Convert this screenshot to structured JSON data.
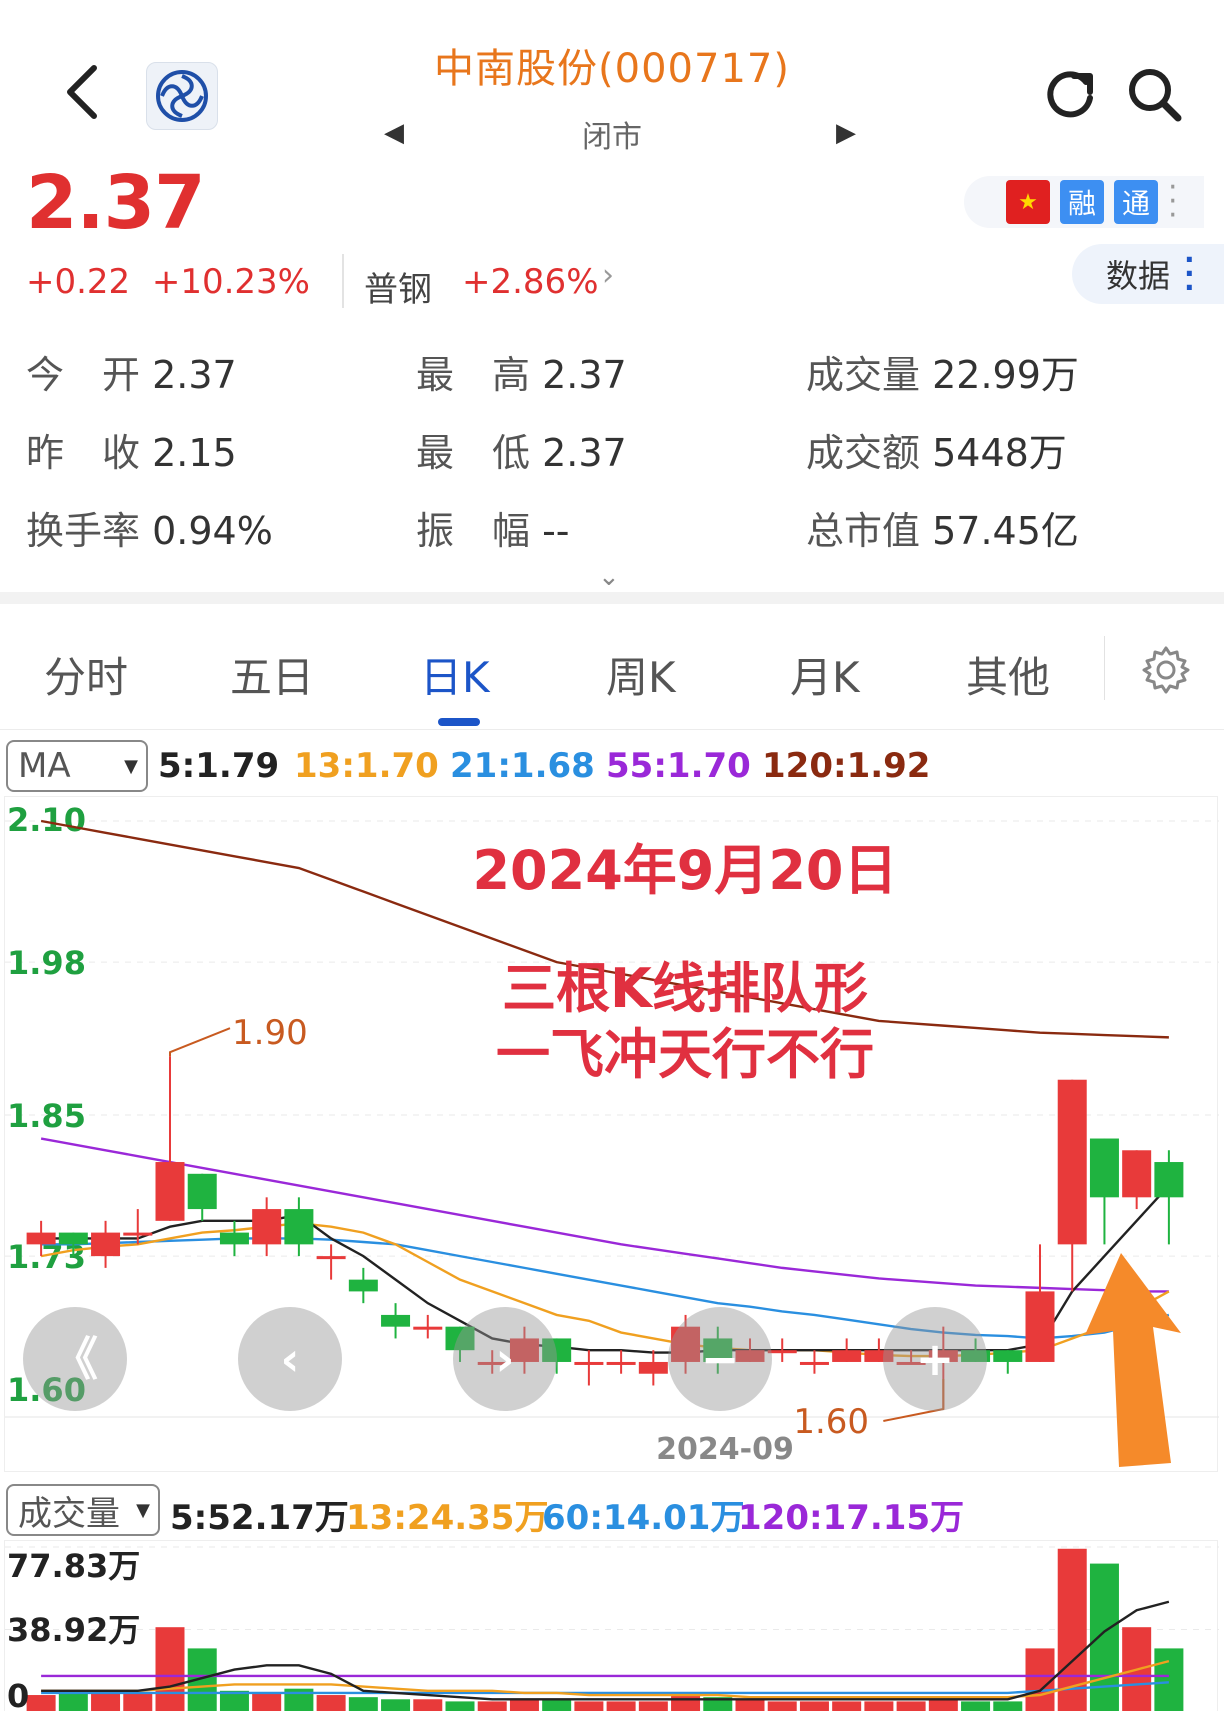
{
  "header": {
    "title": "中南股份(000717)",
    "market_state": "闭市",
    "prev_arrow": "◀",
    "next_arrow": "▶"
  },
  "quote": {
    "price": "2.37",
    "change": "+0.22",
    "change_pct": "+10.23%",
    "sector_name": "普钢",
    "sector_change": "+2.86%"
  },
  "badges": {
    "margin": "融",
    "connect": "通",
    "flag": "★"
  },
  "data_button": {
    "label": "数据"
  },
  "stats": [
    {
      "label": "今　开",
      "value": "2.37"
    },
    {
      "label": "最　高",
      "value": "2.37"
    },
    {
      "label": "成交量",
      "value": "22.99万"
    },
    {
      "label": "昨　收",
      "value": "2.15"
    },
    {
      "label": "最　低",
      "value": "2.37"
    },
    {
      "label": "成交额",
      "value": "5448万"
    },
    {
      "label": "换手率",
      "value": "0.94%"
    },
    {
      "label": "振　幅",
      "value": "--"
    },
    {
      "label": "总市值",
      "value": "57.45亿"
    }
  ],
  "tabs": [
    "分时",
    "五日",
    "日K",
    "周K",
    "月K",
    "其他"
  ],
  "active_tab": 2,
  "ma_bar": {
    "selector": "MA",
    "items": [
      {
        "text": "5:1.79",
        "color": "#222222"
      },
      {
        "text": "13:1.70",
        "color": "#f0a020"
      },
      {
        "text": "21:1.68",
        "color": "#2a8fe0"
      },
      {
        "text": "55:1.70",
        "color": "#9a28d8"
      },
      {
        "text": "120:1.92",
        "color": "#8a2a10"
      }
    ]
  },
  "vol_bar": {
    "selector": "成交量",
    "items": [
      {
        "text": "5:52.17万",
        "color": "#222222"
      },
      {
        "text": "13:24.35万",
        "color": "#f0a020"
      },
      {
        "text": "60:14.01万",
        "color": "#2a8fe0"
      },
      {
        "text": "120:17.15万",
        "color": "#9a28d8"
      }
    ]
  },
  "annotations": {
    "date": "2024年9月20日",
    "line1": "三根K线排队形",
    "line2": "一飞冲天行不行",
    "high_marker": "1.90",
    "low_marker": "1.60"
  },
  "controls": [
    "《",
    "‹",
    "›",
    "−",
    "+"
  ],
  "colors": {
    "up": "#e83a3a",
    "down": "#1fb340",
    "accent": "#1c55c8",
    "title": "#e8761c"
  },
  "chart_data": {
    "type": "candlestick",
    "x_label": "2024-09",
    "price_axis": [
      "2.10",
      "1.98",
      "1.85",
      "1.73",
      "1.60"
    ],
    "ylim": [
      1.6,
      2.1
    ],
    "candles": [
      {
        "o": 1.74,
        "c": 1.75,
        "h": 1.76,
        "l": 1.73
      },
      {
        "o": 1.75,
        "c": 1.74,
        "h": 1.75,
        "l": 1.73
      },
      {
        "o": 1.73,
        "c": 1.75,
        "h": 1.76,
        "l": 1.72
      },
      {
        "o": 1.75,
        "c": 1.75,
        "h": 1.77,
        "l": 1.74
      },
      {
        "o": 1.76,
        "c": 1.81,
        "h": 1.9,
        "l": 1.76
      },
      {
        "o": 1.8,
        "c": 1.77,
        "h": 1.8,
        "l": 1.76
      },
      {
        "o": 1.75,
        "c": 1.74,
        "h": 1.76,
        "l": 1.73
      },
      {
        "o": 1.74,
        "c": 1.77,
        "h": 1.78,
        "l": 1.73
      },
      {
        "o": 1.77,
        "c": 1.74,
        "h": 1.78,
        "l": 1.73
      },
      {
        "o": 1.73,
        "c": 1.73,
        "h": 1.74,
        "l": 1.71
      },
      {
        "o": 1.71,
        "c": 1.7,
        "h": 1.72,
        "l": 1.69
      },
      {
        "o": 1.68,
        "c": 1.67,
        "h": 1.69,
        "l": 1.66
      },
      {
        "o": 1.67,
        "c": 1.67,
        "h": 1.68,
        "l": 1.66
      },
      {
        "o": 1.67,
        "c": 1.65,
        "h": 1.67,
        "l": 1.64
      },
      {
        "o": 1.64,
        "c": 1.64,
        "h": 1.65,
        "l": 1.63
      },
      {
        "o": 1.64,
        "c": 1.66,
        "h": 1.67,
        "l": 1.63
      },
      {
        "o": 1.66,
        "c": 1.64,
        "h": 1.66,
        "l": 1.63
      },
      {
        "o": 1.64,
        "c": 1.64,
        "h": 1.65,
        "l": 1.62
      },
      {
        "o": 1.64,
        "c": 1.64,
        "h": 1.65,
        "l": 1.63
      },
      {
        "o": 1.63,
        "c": 1.64,
        "h": 1.65,
        "l": 1.62
      },
      {
        "o": 1.64,
        "c": 1.67,
        "h": 1.68,
        "l": 1.63
      },
      {
        "o": 1.66,
        "c": 1.64,
        "h": 1.67,
        "l": 1.63
      },
      {
        "o": 1.64,
        "c": 1.65,
        "h": 1.66,
        "l": 1.64
      },
      {
        "o": 1.65,
        "c": 1.65,
        "h": 1.66,
        "l": 1.64
      },
      {
        "o": 1.64,
        "c": 1.64,
        "h": 1.65,
        "l": 1.63
      },
      {
        "o": 1.64,
        "c": 1.65,
        "h": 1.66,
        "l": 1.64
      },
      {
        "o": 1.64,
        "c": 1.65,
        "h": 1.66,
        "l": 1.64
      },
      {
        "o": 1.64,
        "c": 1.64,
        "h": 1.65,
        "l": 1.64
      },
      {
        "o": 1.64,
        "c": 1.65,
        "h": 1.67,
        "l": 1.6
      },
      {
        "o": 1.65,
        "c": 1.64,
        "h": 1.66,
        "l": 1.64
      },
      {
        "o": 1.65,
        "c": 1.64,
        "h": 1.65,
        "l": 1.63
      },
      {
        "o": 1.64,
        "c": 1.7,
        "h": 1.74,
        "l": 1.64
      },
      {
        "o": 1.74,
        "c": 1.88,
        "h": 1.88,
        "l": 1.7
      },
      {
        "o": 1.83,
        "c": 1.78,
        "h": 1.83,
        "l": 1.74
      },
      {
        "o": 1.78,
        "c": 1.82,
        "h": 1.82,
        "l": 1.77
      },
      {
        "o": 1.81,
        "c": 1.78,
        "h": 1.82,
        "l": 1.74
      }
    ],
    "ma5": [
      1.745,
      1.745,
      1.745,
      1.745,
      1.755,
      1.76,
      1.76,
      1.76,
      1.765,
      1.745,
      1.73,
      1.71,
      1.69,
      1.675,
      1.66,
      1.655,
      1.653,
      1.65,
      1.65,
      1.648,
      1.648,
      1.65,
      1.65,
      1.65,
      1.65,
      1.65,
      1.65,
      1.65,
      1.65,
      1.65,
      1.65,
      1.655,
      1.7,
      1.73,
      1.76,
      1.79
    ],
    "ma13": [
      1.73,
      1.735,
      1.738,
      1.74,
      1.745,
      1.75,
      1.752,
      1.755,
      1.758,
      1.755,
      1.75,
      1.74,
      1.725,
      1.71,
      1.7,
      1.69,
      1.68,
      1.675,
      1.665,
      1.66,
      1.655,
      1.652,
      1.65,
      1.65,
      1.65,
      1.648,
      1.646,
      1.645,
      1.645,
      1.646,
      1.648,
      1.65,
      1.66,
      1.67,
      1.685,
      1.7
    ],
    "ma21": [
      1.74,
      1.74,
      1.741,
      1.742,
      1.743,
      1.744,
      1.745,
      1.745,
      1.745,
      1.744,
      1.742,
      1.74,
      1.735,
      1.73,
      1.725,
      1.72,
      1.715,
      1.71,
      1.705,
      1.7,
      1.695,
      1.69,
      1.687,
      1.683,
      1.68,
      1.676,
      1.672,
      1.668,
      1.665,
      1.663,
      1.662,
      1.66,
      1.662,
      1.665,
      1.672,
      1.68
    ],
    "ma55": [
      1.83,
      1.825,
      1.82,
      1.815,
      1.81,
      1.805,
      1.8,
      1.795,
      1.79,
      1.785,
      1.78,
      1.775,
      1.77,
      1.765,
      1.76,
      1.755,
      1.75,
      1.745,
      1.74,
      1.736,
      1.732,
      1.728,
      1.724,
      1.72,
      1.717,
      1.714,
      1.711,
      1.709,
      1.707,
      1.705,
      1.704,
      1.703,
      1.702,
      1.701,
      1.7,
      1.7
    ],
    "ma120": [
      2.1,
      2.095,
      2.09,
      2.085,
      2.08,
      2.075,
      2.07,
      2.065,
      2.06,
      2.05,
      2.04,
      2.03,
      2.02,
      2.01,
      2.0,
      1.99,
      1.98,
      1.975,
      1.97,
      1.965,
      1.96,
      1.955,
      1.95,
      1.945,
      1.94,
      1.935,
      1.93,
      1.928,
      1.926,
      1.924,
      1.922,
      1.92,
      1.919,
      1.918,
      1.917,
      1.916
    ],
    "volume_axis": [
      "77.83万",
      "38.92万",
      "0"
    ],
    "volume": [
      8,
      9,
      10,
      9,
      40,
      30,
      10,
      9,
      11,
      8,
      7,
      6,
      6,
      5,
      5,
      6,
      6,
      5,
      5,
      5,
      8,
      7,
      6,
      5,
      5,
      5,
      5,
      5,
      6,
      5,
      5,
      30,
      77,
      70,
      40,
      30
    ],
    "vol_ma5": [
      10,
      10,
      10,
      10,
      12,
      16,
      20,
      22,
      22,
      18,
      10,
      9,
      8,
      7,
      6,
      6,
      6,
      6,
      6,
      6,
      6,
      6,
      6,
      6,
      6,
      6,
      6,
      6,
      6,
      6,
      6,
      10,
      24,
      38,
      48,
      52
    ],
    "vol_ma13": [
      10,
      10,
      10,
      10,
      11,
      12,
      13,
      13,
      13,
      13,
      12,
      11,
      10,
      10,
      10,
      9,
      9,
      8,
      8,
      8,
      8,
      8,
      7,
      7,
      7,
      7,
      7,
      7,
      7,
      7,
      7,
      8,
      12,
      16,
      20,
      24
    ],
    "vol_ma60": [
      9,
      9,
      9,
      9,
      9,
      9,
      9,
      9,
      9,
      9,
      9,
      9,
      9,
      9,
      9,
      9,
      9,
      9,
      9,
      9,
      9,
      9,
      9,
      9,
      9,
      9,
      9,
      9,
      9,
      9,
      9,
      10,
      11,
      12,
      13,
      14
    ],
    "vol_ma120": [
      17,
      17,
      17,
      17,
      17,
      17,
      17,
      17,
      17,
      17,
      17,
      17,
      17,
      17,
      17,
      17,
      17,
      17,
      17,
      17,
      17,
      17,
      17,
      17,
      17,
      17,
      17,
      17,
      17,
      17,
      17,
      17,
      17,
      17,
      17,
      17
    ]
  }
}
